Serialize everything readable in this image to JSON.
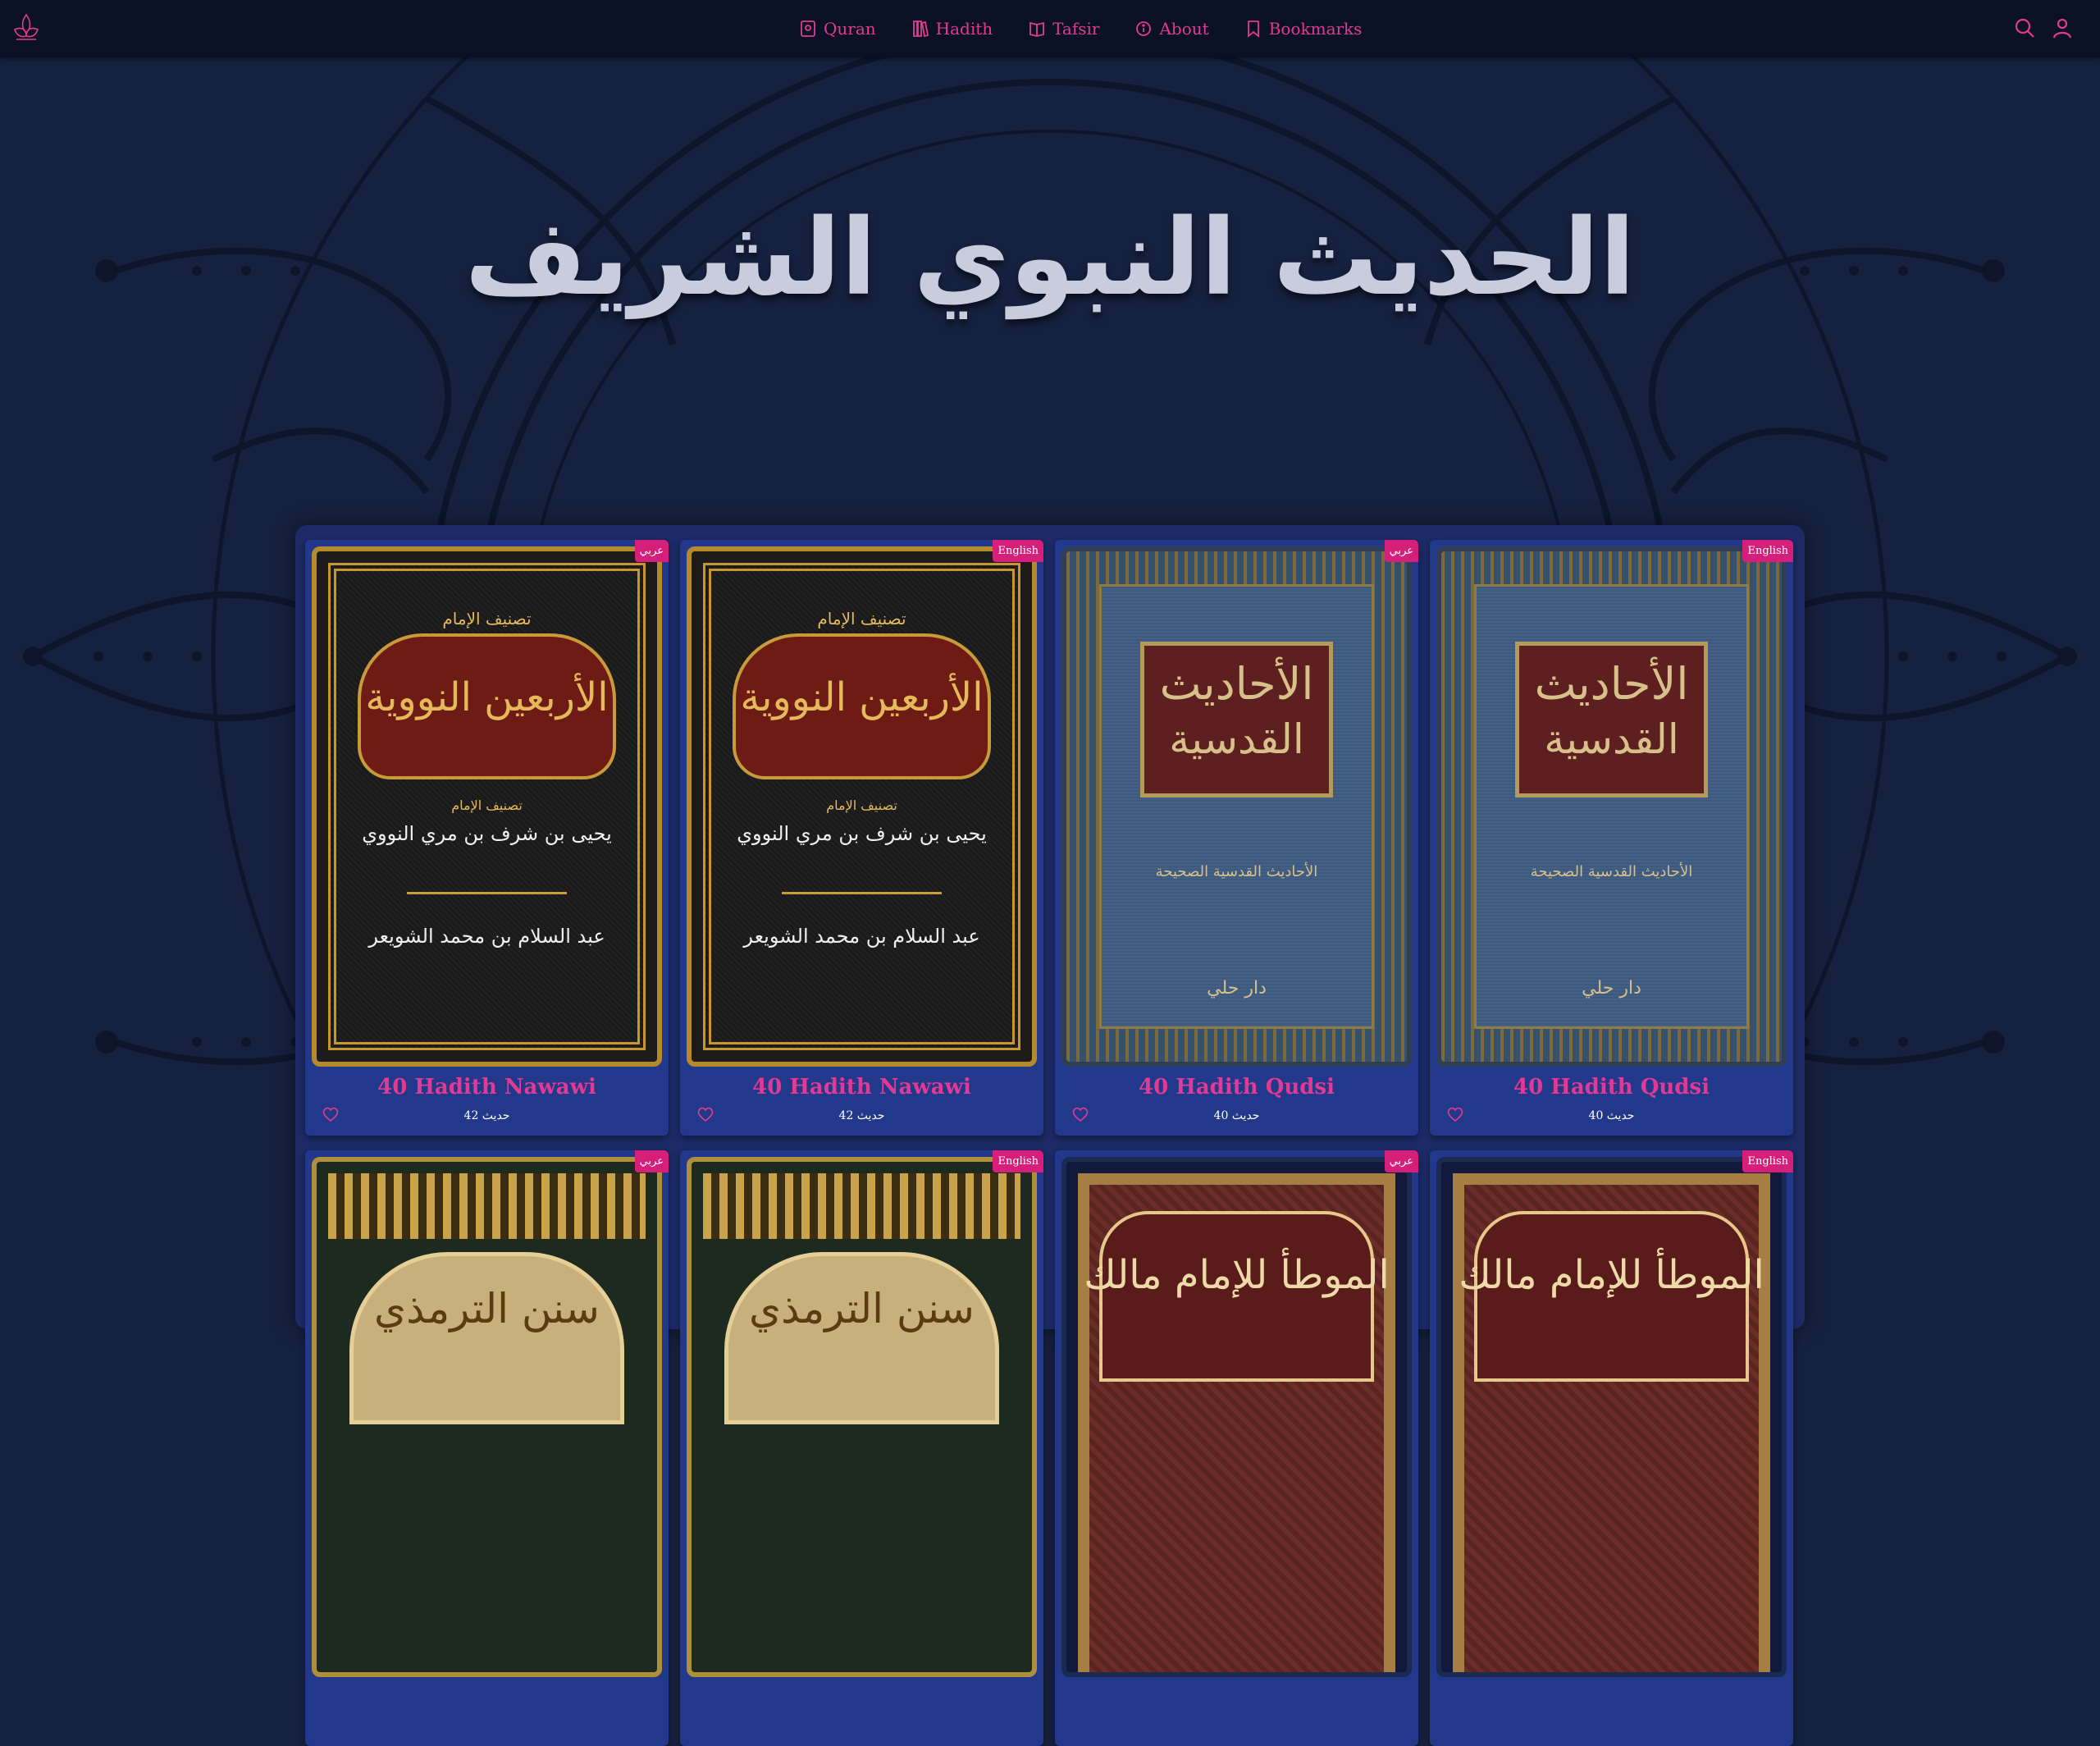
{
  "nav": {
    "items": [
      {
        "label": "Quran",
        "icon": "quran-book-icon"
      },
      {
        "label": "Hadith",
        "icon": "books-icon"
      },
      {
        "label": "Tafsir",
        "icon": "open-book-icon"
      },
      {
        "label": "About",
        "icon": "info-icon"
      },
      {
        "label": "Bookmarks",
        "icon": "bookmark-icon"
      }
    ],
    "search_icon": "search-icon",
    "user_icon": "user-icon"
  },
  "hero": {
    "title": "الحديث النبوي الشريف"
  },
  "colors": {
    "accent": "#e03a94",
    "badge": "#d61f7b",
    "background": "#16213f",
    "panel": "#1c2a66",
    "card": "#22388a",
    "nav_bg": "#0b1124"
  },
  "cards": [
    {
      "title": "40 Hadith Nawawi",
      "count": "حديث 42",
      "lang": "عربي",
      "cover": {
        "heading": "الأربعين النووية",
        "sub1": "تصنيف الإمام",
        "sub2": "يحيى بن شرف بن مري النووي",
        "sub3": "عبد السلام بن محمد الشويعر"
      }
    },
    {
      "title": "40 Hadith Nawawi",
      "count": "حديث 42",
      "lang": "English",
      "cover": {
        "heading": "الأربعين النووية",
        "sub1": "تصنيف الإمام",
        "sub2": "يحيى بن شرف بن مري النووي",
        "sub3": "عبد السلام بن محمد الشويعر"
      }
    },
    {
      "title": "40 Hadith Qudsi",
      "count": "حديث 40",
      "lang": "عربي",
      "cover": {
        "heading1": "الأحاديث",
        "heading2": "القدسية",
        "sub1": "الأحاديث القدسية الصحيحة",
        "sub2": "دار حلي"
      }
    },
    {
      "title": "40 Hadith Qudsi",
      "count": "حديث 40",
      "lang": "English",
      "cover": {
        "heading1": "الأحاديث",
        "heading2": "القدسية",
        "sub1": "الأحاديث القدسية الصحيحة",
        "sub2": "دار حلي"
      }
    },
    {
      "lang": "عربي",
      "cover": {
        "heading": "سنن الترمذي"
      }
    },
    {
      "lang": "English",
      "cover": {
        "heading": "سنن الترمذي"
      }
    },
    {
      "lang": "عربي",
      "cover": {
        "heading": "الموطأ للإمام مالك"
      }
    },
    {
      "lang": "English",
      "cover": {
        "heading": "الموطأ للإمام مالك"
      }
    }
  ]
}
